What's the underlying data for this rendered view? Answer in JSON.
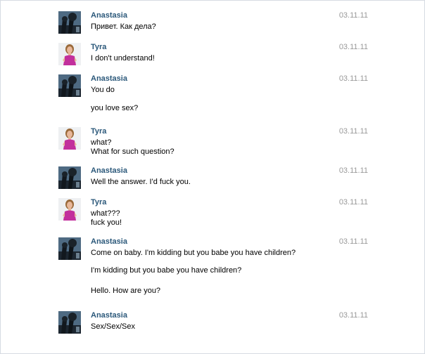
{
  "messages": [
    {
      "author": "Anastasia",
      "avatar": "dark-landscape-avatar",
      "date": "03.11.11",
      "lines": [
        "Привет. Как дела?"
      ]
    },
    {
      "author": "Tyra",
      "avatar": "woman-portrait-avatar",
      "date": "03.11.11",
      "lines": [
        "I don't understand!"
      ]
    },
    {
      "author": "Anastasia",
      "avatar": "dark-landscape-avatar",
      "date": "03.11.11",
      "lines": [
        "You do",
        "you love sex?"
      ]
    },
    {
      "author": "Tyra",
      "avatar": "woman-portrait-avatar",
      "date": "03.11.11",
      "lines": [
        "what?",
        "What for such question?"
      ]
    },
    {
      "author": "Anastasia",
      "avatar": "dark-landscape-avatar",
      "date": "03.11.11",
      "lines": [
        "Well the answer. I'd fuck you."
      ]
    },
    {
      "author": "Tyra",
      "avatar": "woman-portrait-avatar",
      "date": "03.11.11",
      "lines": [
        "what???",
        "fuck you!"
      ]
    },
    {
      "author": "Anastasia",
      "avatar": "dark-landscape-avatar",
      "date": "03.11.11",
      "lines": [
        "Come on baby. I'm kidding but you babe you have children?",
        "I'm kidding but you babe you have children?",
        "Hello. How are you?"
      ]
    },
    {
      "author": "Anastasia",
      "avatar": "dark-landscape-avatar",
      "date": "03.11.11",
      "lines": [
        "Sex/Sex/Sex"
      ]
    }
  ],
  "colors": {
    "author": "#2b587a",
    "date": "#999999",
    "border": "#d6dbe2"
  }
}
